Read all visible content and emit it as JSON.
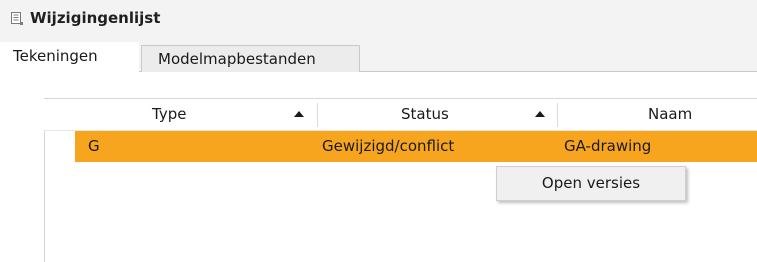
{
  "window": {
    "title": "Wijzigingenlijst",
    "icon": "list-document-icon"
  },
  "tabs": [
    {
      "label": "Tekeningen",
      "active": true
    },
    {
      "label": "Modelmapbestanden",
      "active": false
    }
  ],
  "table": {
    "columns": [
      {
        "label": "Type",
        "sort": "ascending"
      },
      {
        "label": "Status",
        "sort": "ascending"
      },
      {
        "label": "Naam",
        "sort": null
      }
    ],
    "rows": [
      {
        "type": "G",
        "status": "Gewijzigd/conflict",
        "name": "GA-drawing",
        "selected": true
      }
    ],
    "highlight_color": "#f7a51f"
  },
  "context_menu": {
    "items": [
      {
        "label": "Open versies"
      }
    ]
  }
}
